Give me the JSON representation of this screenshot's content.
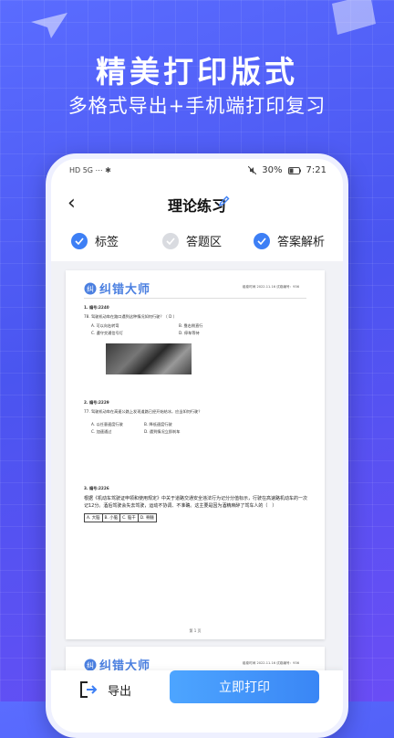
{
  "hero": {
    "title": "精美打印版式",
    "subtitle": "多格式导出+手机端打印复习"
  },
  "status_bar": {
    "left_icons": "HD 5G ⋯ ✱",
    "battery": "30%",
    "time": "7:21"
  },
  "nav": {
    "title": "理论练习",
    "back_icon": "chevron-left-icon",
    "edit_icon": "pencil-icon"
  },
  "options": [
    {
      "label": "标签",
      "checked": true
    },
    {
      "label": "答题区",
      "checked": false
    },
    {
      "label": "答案解析",
      "checked": true
    }
  ],
  "document": {
    "logo_text": "纠错大师",
    "meta": "组卷时间 2022.11.16 试卷编号：936",
    "q1_id": "1. 编号:2240",
    "q1_text": "78. 驾驶机动车在路口遇到这种情况如何行驶？（ D ）",
    "q1_opts": [
      "A. 可以向右转弯",
      "B. 靠右侧直行",
      "C. 遵守交通信号灯",
      "D. 停车等待"
    ],
    "q2_id": "2. 编号:2229",
    "q2_text": "77. 驾驶机动车在高速公路上发现道路已经开始结冰，应当如何行驶？",
    "q2_opts": [
      "A. 以任意速度行驶",
      "B. 降低速度行驶",
      "C. 加速通过",
      "D. 遇到情况立即刹车"
    ],
    "q3_id": "3. 编号:2226",
    "q3_text": "根据《机动车驾驶证申领和使用规定》中关于道路交通安全违法行为记分分值标示，行驶在高速路机动车的一次记12分。酒后驾驶会失去驾驶，运动不协调、不准确。这主要是因为酒精麻醉了驾车人的（　）",
    "q3_opts": [
      "A. 大脑",
      "B. 小脑",
      "C. 脑干",
      "D. 脊髓"
    ],
    "page_num": "第 1 页"
  },
  "bottom": {
    "export_label": "导出",
    "print_label": "立即打印"
  },
  "colors": {
    "accent": "#3d7ff5",
    "background": "#5160f5"
  }
}
